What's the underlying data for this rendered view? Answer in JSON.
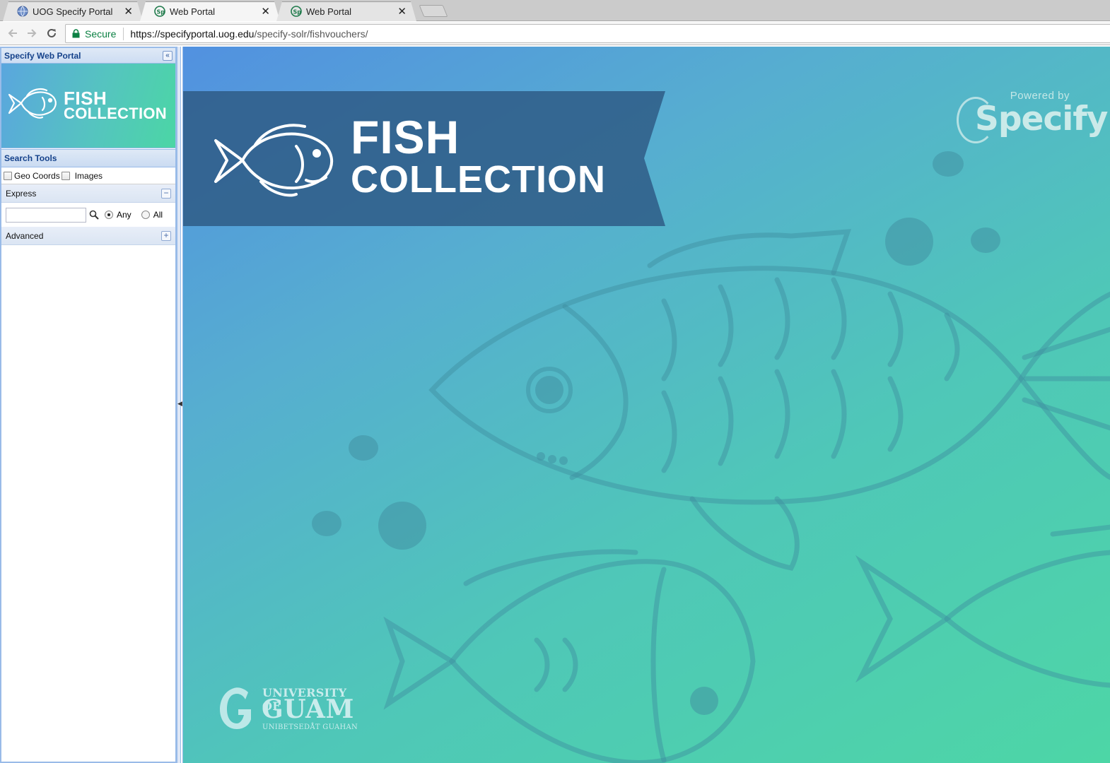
{
  "browser": {
    "tabs": [
      {
        "title": "UOG Specify Portal",
        "active": false,
        "favicon": "globe-icon"
      },
      {
        "title": "Web Portal",
        "active": true,
        "favicon": "specify-icon"
      },
      {
        "title": "Web Portal",
        "active": false,
        "favicon": "specify-icon"
      }
    ],
    "close_glyph": "✕",
    "address": {
      "secure_label": "Secure",
      "url_host": "https://specifyportal.uog.edu",
      "url_path": "/specify-solr/fishvouchers/"
    }
  },
  "sidebar": {
    "title": "Specify Web Portal",
    "collapse_glyph": "«",
    "banner": {
      "line1": "FISH",
      "line2": "COLLECTION"
    },
    "search_tools": {
      "title": "Search Tools",
      "options": [
        {
          "label": "Geo Coords",
          "checked": false
        },
        {
          "label": "Images",
          "checked": false
        }
      ]
    },
    "express": {
      "title": "Express",
      "toggle": "−",
      "input_value": "",
      "match": [
        {
          "label": "Any",
          "selected": true
        },
        {
          "label": "All",
          "selected": false
        }
      ]
    },
    "advanced": {
      "title": "Advanced",
      "toggle": "+"
    }
  },
  "main": {
    "banner": {
      "line1": "FISH",
      "line2": "COLLECTION"
    },
    "powered_by": {
      "label": "Powered by",
      "brand": "Specify"
    },
    "university": {
      "line1": "UNIVERSITY OF",
      "line2": "GUAM",
      "line3": "UNIBETSEDÅT GUAHAN"
    },
    "colors": {
      "ribbon": "#2f5c86",
      "gradient_start": "#5291e0",
      "gradient_end": "#4dd6a6"
    }
  }
}
